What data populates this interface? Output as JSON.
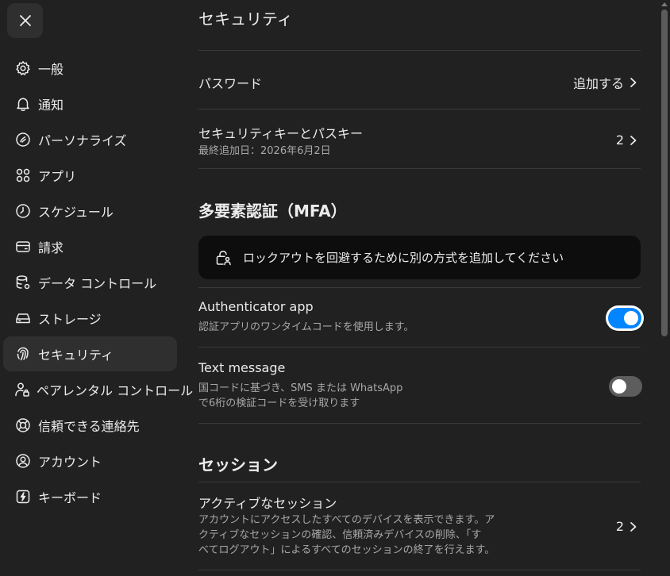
{
  "sidebar": {
    "items": [
      {
        "label": "一般",
        "icon": "gear-icon"
      },
      {
        "label": "通知",
        "icon": "bell-icon"
      },
      {
        "label": "パーソナライズ",
        "icon": "personalize-icon"
      },
      {
        "label": "アプリ",
        "icon": "apps-grid-icon"
      },
      {
        "label": "スケジュール",
        "icon": "clock-icon"
      },
      {
        "label": "請求",
        "icon": "card-icon"
      },
      {
        "label": "データ コントロール",
        "icon": "database-gear-icon"
      },
      {
        "label": "ストレージ",
        "icon": "storage-icon"
      },
      {
        "label": "セキュリティ",
        "icon": "fingerprint-icon",
        "active": true
      },
      {
        "label": "ペアレンタル コントロール",
        "icon": "parental-icon"
      },
      {
        "label": "信頼できる連絡先",
        "icon": "lifebuoy-icon"
      },
      {
        "label": "アカウント",
        "icon": "account-icon"
      },
      {
        "label": "キーボード",
        "icon": "keyboard-icon"
      }
    ]
  },
  "main": {
    "title": "セキュリティ",
    "password": {
      "label": "パスワード",
      "action": "追加する"
    },
    "passkeys": {
      "label": "セキュリティキーとパスキー",
      "sub": "最終追加日：2026年6月2日",
      "count": "2"
    },
    "mfa": {
      "title": "多要素認証（MFA）",
      "banner": "ロックアウトを回避するために別の方式を追加してください",
      "authenticator": {
        "label": "Authenticator app",
        "sub": "認証アプリのワンタイムコードを使用します。",
        "enabled": true
      },
      "text_message": {
        "label": "Text message",
        "sub1": "国コードに基づき、SMS または WhatsApp",
        "sub2": "で6桁の検証コードを受け取ります",
        "enabled": false
      }
    },
    "sessions": {
      "title": "セッション",
      "active": {
        "label": "アクティブなセッション",
        "sub1": "アカウントにアクセスしたすべてのデバイスを表示できます。ア",
        "sub2": "クティブなセッションの確認、信頼済みデバイスの削除、「す",
        "sub3": "べてログアウト」によるすべてのセッションの終了を行えます。",
        "count": "2"
      }
    }
  },
  "colors": {
    "accent": "#0285ff",
    "background": "#212121",
    "active_item": "#2f2f2f",
    "banner": "#0d0d0d"
  }
}
